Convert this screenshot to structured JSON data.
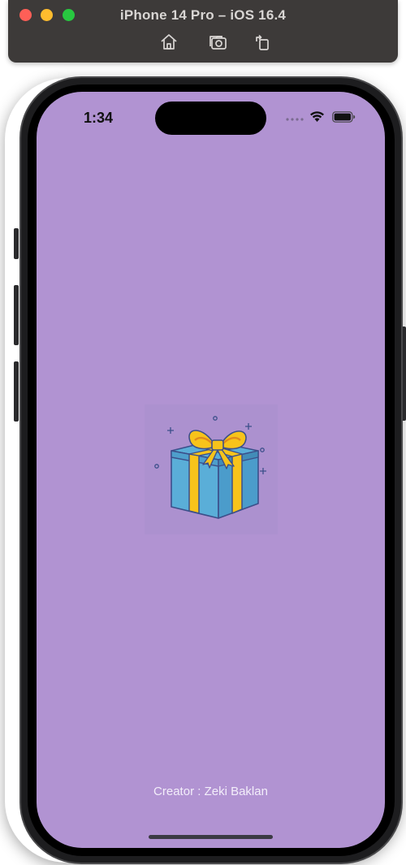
{
  "simulator": {
    "title": "iPhone 14 Pro – iOS 16.4",
    "toolbar_icons": [
      "home-icon",
      "screenshot-icon",
      "rotate-icon"
    ],
    "traffic_lights": {
      "close": "#fe5f57",
      "minimize": "#febc2e",
      "zoom": "#28c840"
    }
  },
  "status_bar": {
    "time": "1:34",
    "icons": [
      "signal-dots-icon",
      "wifi-icon",
      "battery-icon"
    ]
  },
  "screen": {
    "background_color": "#b193d2",
    "illustration": "gift-box-icon",
    "creator_text": "Creator : Zeki Baklan"
  }
}
